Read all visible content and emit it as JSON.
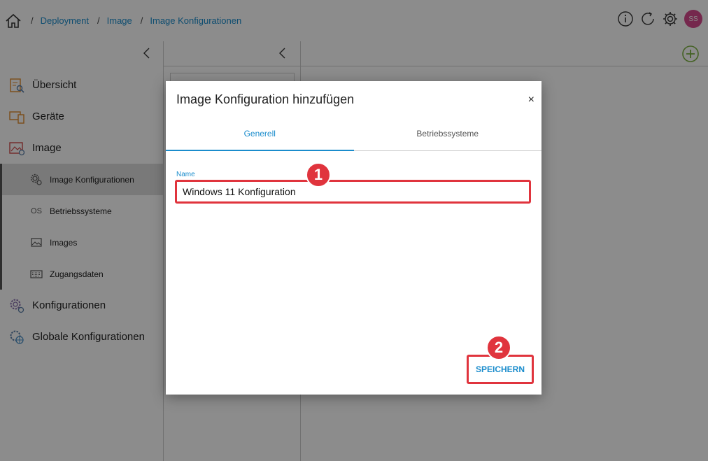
{
  "breadcrumb": {
    "items": [
      "Deployment",
      "Image",
      "Image Konfigurationen"
    ],
    "separator": "/"
  },
  "header": {
    "avatar_initials": "SS"
  },
  "sidebar": {
    "items": [
      {
        "label": "Übersicht",
        "icon": "overview-icon"
      },
      {
        "label": "Geräte",
        "icon": "devices-icon"
      },
      {
        "label": "Image",
        "icon": "image-icon"
      }
    ],
    "sub_items": [
      {
        "label": "Image Konfigurationen",
        "icon": "gear-cluster-icon",
        "active": true
      },
      {
        "label": "Betriebssysteme",
        "icon_text": "OS"
      },
      {
        "label": "Images",
        "icon": "picture-icon"
      },
      {
        "label": "Zugangsdaten",
        "icon": "keyboard-icon"
      }
    ],
    "bottom_items": [
      {
        "label": "Konfigurationen",
        "icon": "settings-icon"
      },
      {
        "label": "Globale Konfigurationen",
        "icon": "global-settings-icon"
      }
    ]
  },
  "dialog": {
    "title": "Image Konfiguration hinzufügen",
    "close_glyph": "×",
    "tabs": [
      {
        "label": "Generell",
        "active": true
      },
      {
        "label": "Betriebssysteme",
        "active": false
      }
    ],
    "name_label": "Name",
    "name_value": "Windows 11 Konfiguration",
    "save_label": "SPEICHERN"
  },
  "annotations": {
    "step1": "1",
    "step2": "2",
    "color": "#e0343d"
  },
  "colors": {
    "accent": "#1a8ccc",
    "avatar": "#d64a8c",
    "add_button": "#7cb342"
  }
}
